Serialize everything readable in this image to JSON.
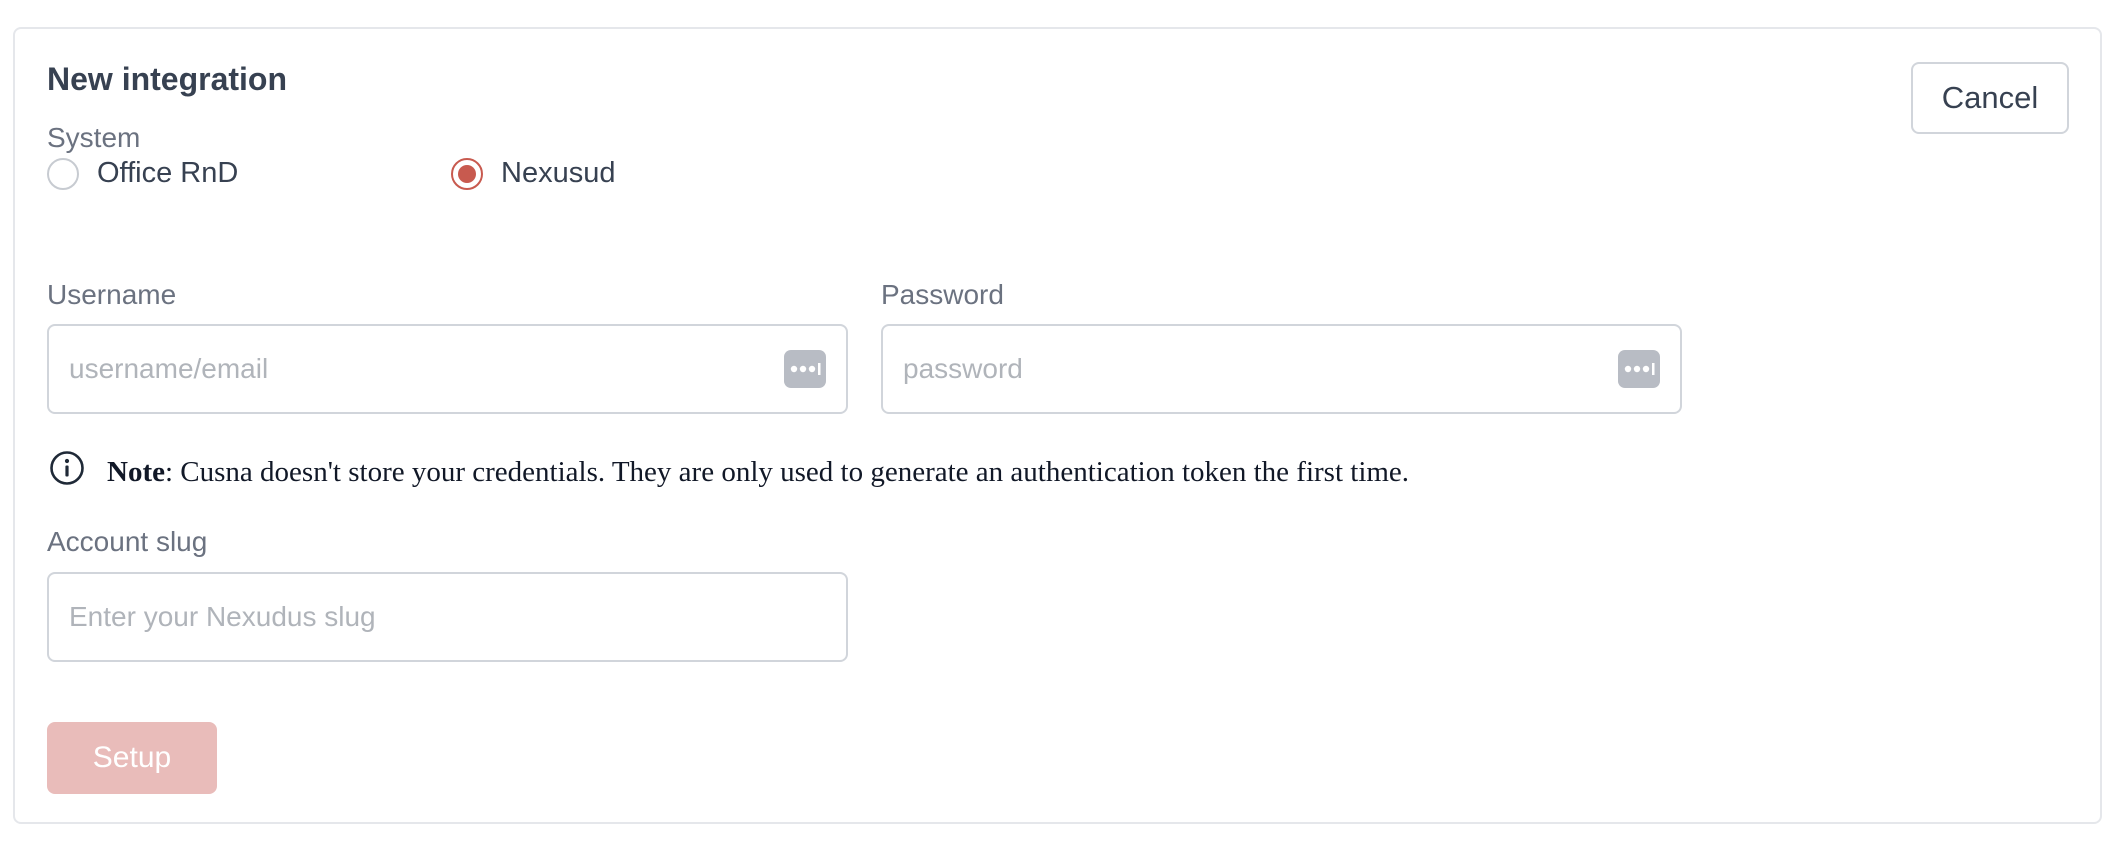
{
  "form": {
    "title": "New integration",
    "cancel_label": "Cancel",
    "system_label": "System",
    "system_options": [
      {
        "label": "Office RnD",
        "selected": false
      },
      {
        "label": "Nexusud",
        "selected": true
      }
    ],
    "username": {
      "label": "Username",
      "placeholder": "username/email",
      "value": ""
    },
    "password": {
      "label": "Password",
      "placeholder": "password",
      "value": ""
    },
    "note": {
      "prefix": "Note",
      "text": ": Cusna doesn't store your credentials. They are only used to generate an authentication token the first time."
    },
    "account_slug": {
      "label": "Account slug",
      "placeholder": "Enter your Nexudus slug",
      "value": ""
    },
    "setup_label": "Setup"
  },
  "icons": {
    "info": "info-circle-icon",
    "password_manager": "password-dots-icon"
  },
  "colors": {
    "accent": "#c85a4f",
    "setup_disabled": "#e9bcba",
    "border": "#d1d5db",
    "muted_text": "#6b7280"
  }
}
